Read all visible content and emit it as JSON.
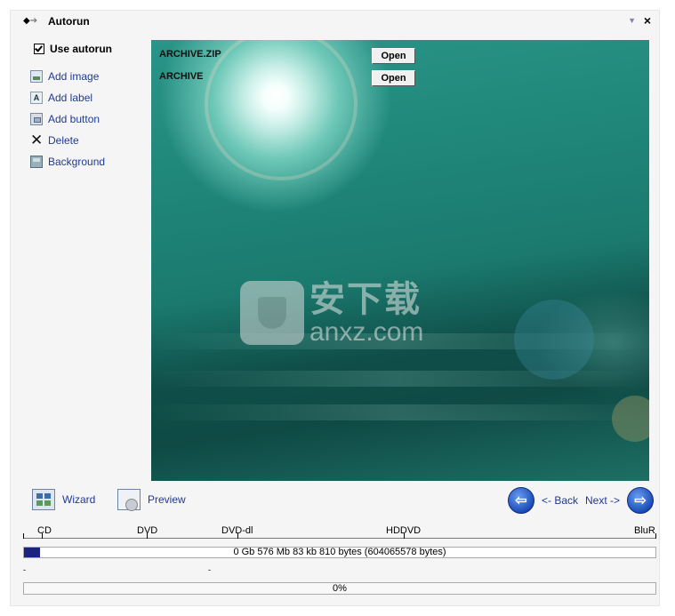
{
  "titlebar": {
    "title": "Autorun",
    "back_icon": "arrow-left-icon",
    "forward_icon": "arrow-right-icon",
    "menu_icon": "chevron-down-icon",
    "close_icon": "close-icon"
  },
  "sidebar": {
    "use_autorun_label": "Use autorun",
    "use_autorun_checked": true,
    "actions": [
      {
        "label": "Add image",
        "icon": "image-icon"
      },
      {
        "label": "Add label",
        "icon": "label-icon"
      },
      {
        "label": "Add button",
        "icon": "button-icon"
      },
      {
        "label": "Delete",
        "icon": "delete-icon"
      },
      {
        "label": "Background",
        "icon": "background-icon"
      }
    ]
  },
  "canvas": {
    "items": [
      {
        "label": "ARCHIVE.ZIP",
        "button": "Open"
      },
      {
        "label": "ARCHIVE",
        "button": "Open"
      }
    ],
    "watermark_cn": "安下载",
    "watermark_en": "anxz.com"
  },
  "bottom_nav": {
    "wizard_label": "Wizard",
    "preview_label": "Preview",
    "back_label": "<- Back",
    "next_label": "Next ->"
  },
  "media_ruler": {
    "labels": [
      "CD",
      "DVD",
      "DVD-dl",
      "HDDVD",
      "BluR"
    ]
  },
  "capacity": {
    "text": "0 Gb  576 Mb  83 kb  810 bytes  (604065578 bytes)",
    "fill_fraction": 0.025
  },
  "progress": {
    "text": "0%",
    "value": 0
  },
  "colors": {
    "link": "#1f3a93",
    "fill": "#1a237e"
  }
}
